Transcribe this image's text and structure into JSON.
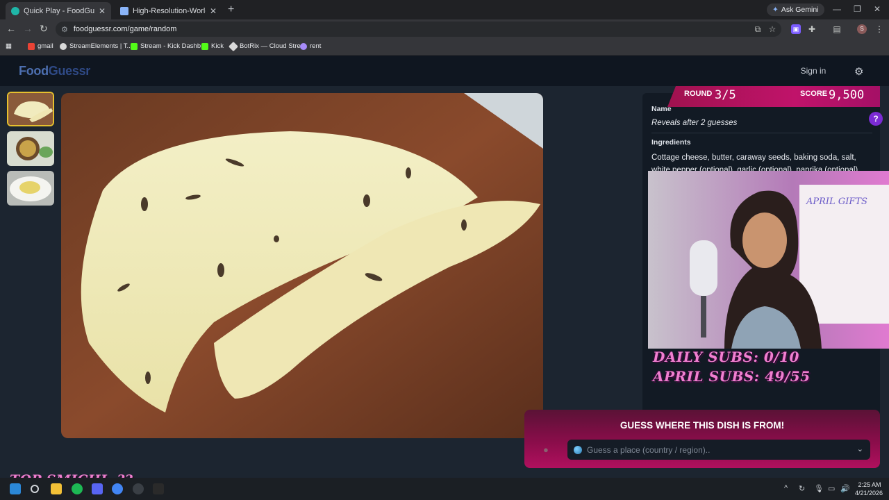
{
  "browser": {
    "tabs": [
      {
        "title": "Quick Play - FoodGuessr | Food",
        "active": true
      },
      {
        "title": "High-Resolution-World-Map.jp",
        "active": false
      }
    ],
    "ask_gemini": "Ask Gemini",
    "url": "foodguessr.com/game/random",
    "bookmarks": [
      "gmail",
      "StreamElements | T...",
      "Stream - Kick Dashb...",
      "Kick",
      "BotRix — Cloud Stre...",
      "rent"
    ],
    "profile_initial": "S"
  },
  "site": {
    "logo_food": "Food",
    "logo_guessr": "Guessr",
    "signin_label": "Sign in"
  },
  "game": {
    "round_label": "ROUND",
    "round_value": "3/5",
    "score_label": "SCORE",
    "score_value": "9,500",
    "name_label": "Name",
    "name_value": "Reveals after 2 guesses",
    "ingredients_label": "Ingredients",
    "ingredients_line1": "Cottage cheese, butter, caraway seeds, baking soda, salt,",
    "ingredients_line2": "white pepper (optional), garlic (optional), paprika (optional)",
    "guess_title": "GUESS WHERE THIS DISH IS FROM!",
    "guess_placeholder": "Guess a place (country / region).."
  },
  "stream_overlay": {
    "daily_subs": "DAILY SUBS: 0/10",
    "april_subs": "APRIL SUBS: 49/55",
    "top_smichi": "TOP SMICHI: ??"
  },
  "taskbar": {
    "time": "2:25 AM",
    "date": "4/21/2026"
  },
  "colors": {
    "accent_pink": "#c0136a",
    "overlay_pink": "#f07fd0",
    "thumb_active": "#e6c02e",
    "help_purple": "#7b2bd4"
  }
}
